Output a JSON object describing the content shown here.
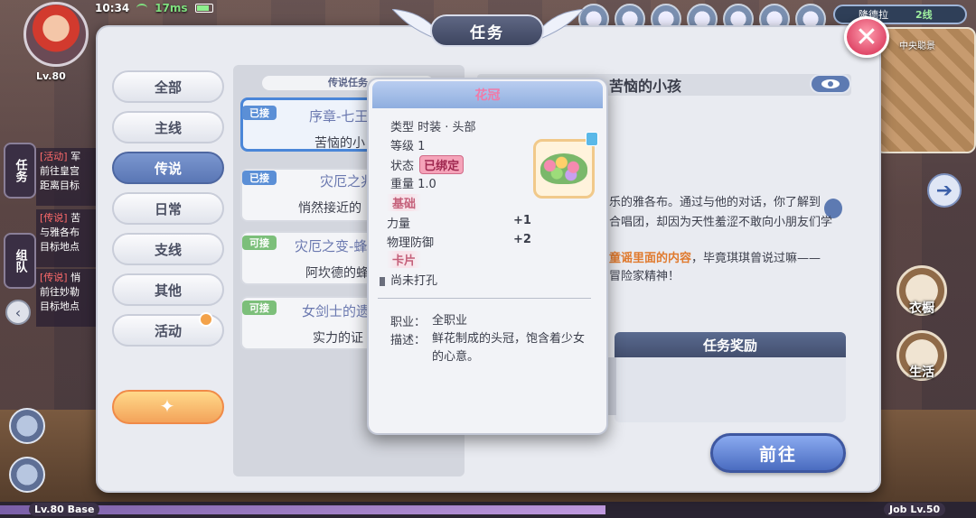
{
  "status_bar": {
    "time": "10:34",
    "ping": "17ms"
  },
  "player": {
    "level": "Lv.80"
  },
  "server": {
    "name": "隆德拉",
    "line": "2线"
  },
  "minimap": {
    "label": "中央聪景"
  },
  "side_tabs": {
    "task": "任务",
    "team": "组队"
  },
  "chat": [
    {
      "tag": "[活动]",
      "text": "军 前往皇宫 距离目标"
    },
    {
      "tag": "[传说]",
      "text": "苦 与雅各布 目标地点"
    },
    {
      "tag": "[传说]",
      "text": "悄 前往妙勒 目标地点"
    }
  ],
  "right_buttons": {
    "wardrobe": "衣橱",
    "life": "生活"
  },
  "exp": {
    "base_label": "Lv.80 Base",
    "job_label": "Job Lv.50",
    "progress": 0.62
  },
  "window": {
    "title": "任务",
    "close_symbol": "✕"
  },
  "categories": [
    "全部",
    "主线",
    "传说",
    "日常",
    "支线",
    "其他",
    "活动"
  ],
  "active_category": "传说",
  "quest_list": {
    "header": "传说任务",
    "items": [
      {
        "badge": "已接",
        "title": "序章-七王",
        "subtitle": "苦恼的小"
      },
      {
        "badge": "已接",
        "title": "灾厄之兆",
        "subtitle": "悄然接近的"
      },
      {
        "badge": "可接",
        "title": "灾厄之变-蜂",
        "subtitle": "阿坎德的蜂"
      },
      {
        "badge": "可接",
        "title": "女剑士的遗",
        "subtitle": "实力的证"
      }
    ]
  },
  "detail": {
    "title": "苦恼的小孩",
    "lines": [
      "乐的雅各布。通过与他的对话，你了解到",
      "合唱团，却因为天性羞涩不敢向小朋友们学",
      "童谣里面的内容，毕竟琪琪曾说过嘛——",
      "冒险家精神！"
    ],
    "highlight": "童谣里面的内容",
    "reward_header": "任务奖励",
    "go_button": "前往"
  },
  "item": {
    "name": "花冠",
    "type_label": "类型",
    "type_value": "时装 · 头部",
    "level_label": "等级",
    "level_value": "1",
    "status_label": "状态",
    "status_value": "已绑定",
    "weight_label": "重量",
    "weight_value": "1.0",
    "base_section": "基础",
    "stats": [
      {
        "name": "力量",
        "value": "+1"
      },
      {
        "name": "物理防御",
        "value": "+2"
      }
    ],
    "card_section": "卡片",
    "card_slot": "尚未打孔",
    "job_label": "职业：",
    "job_value": "全职业",
    "desc_label": "描述：",
    "desc_value": "鲜花制成的头冠，饱含着少女的心意。"
  }
}
